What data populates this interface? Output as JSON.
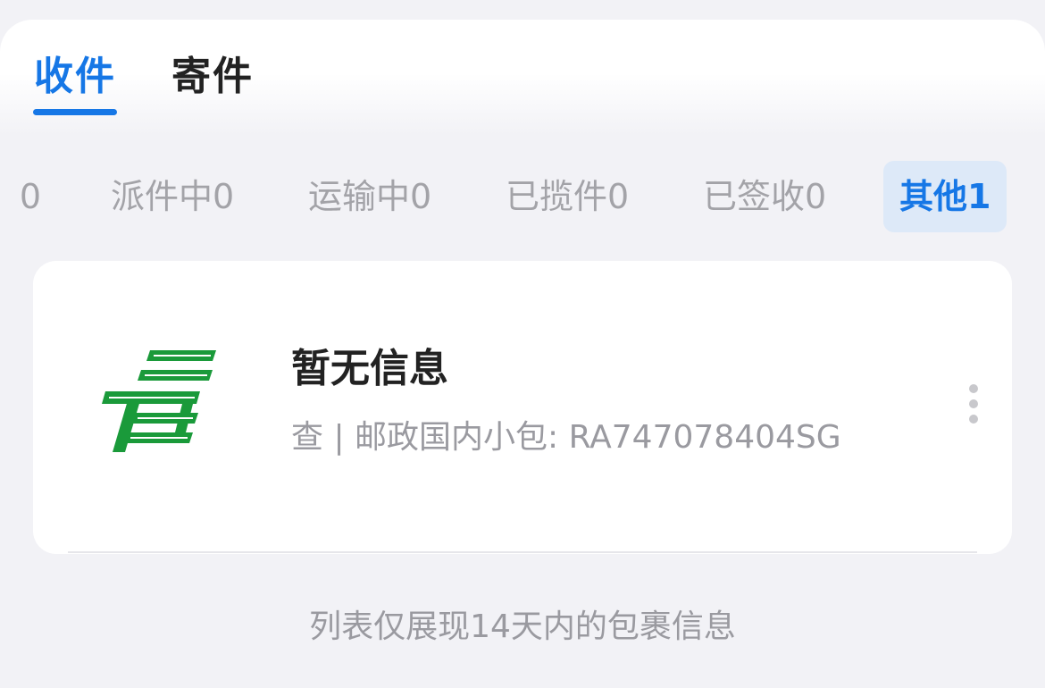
{
  "tabs": {
    "receive_label": "收件",
    "send_label": "寄件",
    "active": "receive"
  },
  "filters": {
    "partial_label": "0",
    "items": [
      {
        "label": "派件中0"
      },
      {
        "label": "运输中0"
      },
      {
        "label": "已揽件0"
      },
      {
        "label": "已签收0"
      },
      {
        "label": "其他1",
        "active": true
      }
    ]
  },
  "package": {
    "status": "暂无信息",
    "detail": "查 | 邮政国内小包: RA747078404SG",
    "carrier_icon": "china-post-logo"
  },
  "footer": {
    "note": "列表仅展现14天内的包裹信息"
  },
  "colors": {
    "accent": "#1677e6",
    "logo_green": "#1a9a3a",
    "active_chip_bg": "#dde9f8"
  }
}
